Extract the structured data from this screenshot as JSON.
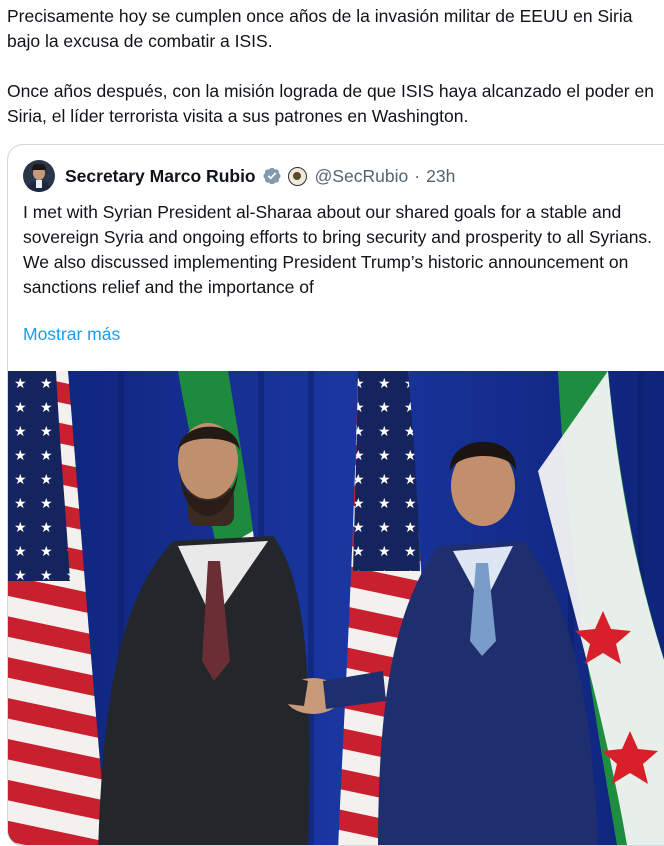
{
  "post": {
    "paragraphs": [
      "Precisamente hoy se cumplen once años de la invasión militar de EEUU en Siria bajo la excusa de combatir a ISIS.",
      "Once años después, con la misión lograda de que ISIS haya alcanzado el poder en Siria, el líder terrorista visita a sus patrones en Washington."
    ]
  },
  "quoted_post": {
    "author_name": "Secretary Marco Rubio",
    "verified_icon": "verified-badge-gray",
    "affiliation_icon": "us-department-of-state-seal",
    "handle": "@SecRubio",
    "separator": "·",
    "timestamp": "23h",
    "text": "I met with Syrian President al-Sharaa about our shared goals for a stable and sovereign Syria and ongoing efforts to bring security and prosperity to all Syrians. We also discussed implementing President Trump’s historic announcement on sanctions relief and the importance of",
    "show_more_label": "Mostrar más",
    "image_alt": "Two men shaking hands in front of United States and Syrian flags"
  },
  "colors": {
    "text_primary": "#0f1419",
    "text_secondary": "#536471",
    "link": "#1d9bf0",
    "border": "#cfd9de",
    "verified_gray": "#829aab"
  }
}
